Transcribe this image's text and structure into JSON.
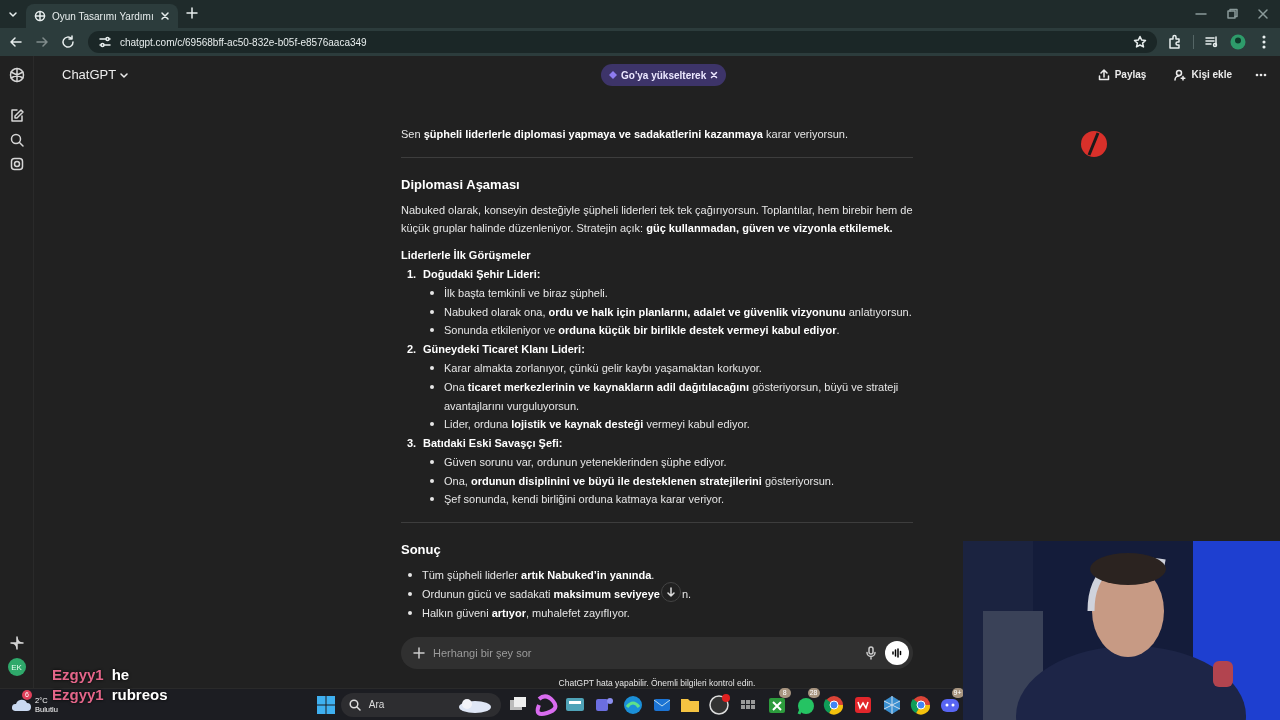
{
  "browser": {
    "tab_title": "Oyun Tasarımı Yardımı",
    "url": "chatgpt.com/c/69568bff-ac50-832e-b05f-e8576aaca349"
  },
  "header": {
    "model": "ChatGPT",
    "upgrade": "Go'ya yükselterek",
    "share": "Paylaş",
    "add_person": "Kişi ekle"
  },
  "sidebar": {
    "avatar": "EK"
  },
  "message": [
    {
      "kind": "paragraph",
      "text": "Sen **şüpheli liderlerle diplomasi yapmaya ve sadakatlerini kazanmaya** karar veriyorsun."
    },
    {
      "kind": "rule"
    },
    {
      "kind": "heading",
      "text": "Diplomasi Aşaması"
    },
    {
      "kind": "paragraph",
      "text": "Nabuked olarak, konseyin desteğiyle şüpheli liderleri tek tek çağırıyorsun. Toplantılar, hem birebir hem de küçük gruplar halinde düzenleniyor. Stratejin açık: **güç kullanmadan, güven ve vizyonla etkilemek.**"
    },
    {
      "kind": "subheading",
      "text": "Liderlerle İlk Görüşmeler"
    },
    {
      "kind": "numbered",
      "items": [
        {
          "marker": "1.",
          "text": "Doğudaki Şehir Lideri:",
          "children": [
            {
              "text": "İlk başta temkinli ve biraz şüpheli."
            },
            {
              "text": "Nabuked olarak ona, **ordu ve halk için planlarını, adalet ve güvenlik vizyonunu** anlatıyorsun."
            },
            {
              "text": "Sonunda etkileniyor ve **orduna küçük bir birlikle destek vermeyi kabul ediyor**."
            }
          ]
        },
        {
          "marker": "2.",
          "text": "Güneydeki Ticaret Klanı Lideri:",
          "children": [
            {
              "text": "Karar almakta zorlanıyor, çünkü gelir kaybı yaşamaktan korkuyor."
            },
            {
              "text": "Ona **ticaret merkezlerinin ve kaynakların adil dağıtılacağını** gösteriyorsun, büyü ve strateji avantajlarını vurguluyorsun."
            },
            {
              "text": "Lider, orduna **lojistik ve kaynak desteği** vermeyi kabul ediyor."
            }
          ]
        },
        {
          "marker": "3.",
          "text": "Batıdaki Eski Savaşçı Şefi:",
          "children": [
            {
              "text": "Güven sorunu var, ordunun yeteneklerinden şüphe ediyor."
            },
            {
              "text": "Ona, **ordunun disiplinini ve büyü ile desteklenen stratejilerini** gösteriyorsun."
            },
            {
              "text": "Şef sonunda, kendi birliğini orduna katmaya karar veriyor."
            }
          ]
        }
      ]
    },
    {
      "kind": "rule"
    },
    {
      "kind": "heading",
      "text": "Sonuç"
    },
    {
      "kind": "bullets",
      "items": [
        {
          "text": "Tüm şüpheli liderler **artık Nabuked’in yanında**."
        },
        {
          "text": "Ordunun gücü ve sadakati **maksimum seviyeye**",
          "text_end": "n."
        },
        {
          "text": "Halkın güveni **artıyor**, muhalefet zayıflıyor."
        }
      ]
    }
  ],
  "composer": {
    "placeholder": "Herhangi bir şey sor",
    "disclaimer": "ChatGPT hata yapabilir. Önemli bilgileri kontrol edin."
  },
  "stream_chat": [
    {
      "user": "Ezgyy1",
      "text": "he"
    },
    {
      "user": "Ezgyy1",
      "text": "rubreos"
    }
  ],
  "taskbar": {
    "weather_badge": "6",
    "temperature": "2°C",
    "condition": "Bulutlu",
    "search": "Ara",
    "apps": [
      {
        "kind": "taskview"
      },
      {
        "kind": "swirl"
      },
      {
        "kind": "screen"
      },
      {
        "kind": "people"
      },
      {
        "kind": "wave"
      },
      {
        "kind": "mail"
      },
      {
        "kind": "folder"
      },
      {
        "kind": "record"
      },
      {
        "kind": "grid"
      },
      {
        "kind": "game",
        "badge": "8"
      },
      {
        "kind": "phone",
        "badge": "28"
      },
      {
        "kind": "browser"
      },
      {
        "kind": "document"
      },
      {
        "kind": "cube"
      },
      {
        "kind": "browser"
      },
      {
        "kind": "controller",
        "badge": "9+"
      }
    ]
  }
}
